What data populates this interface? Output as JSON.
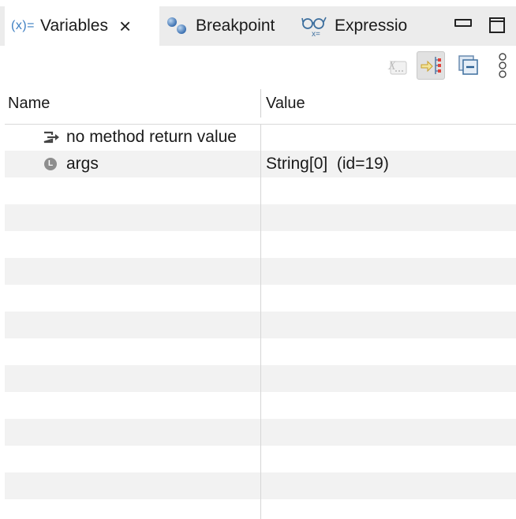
{
  "tabs": [
    {
      "icon_text": "(x)=",
      "icon": "variables-icon",
      "label": "Variables",
      "close": "×",
      "active": true
    },
    {
      "icon": "breakpoint-icon",
      "label": "Breakpoint",
      "active": false
    },
    {
      "icon": "expressions-icon",
      "label": "Expressio",
      "active": false
    }
  ],
  "window_controls": {
    "minimize": "minimize-icon",
    "maximize": "maximize-icon"
  },
  "toolbar": {
    "buttons": [
      {
        "icon": "show-logical-structure-icon",
        "enabled": false
      },
      {
        "icon": "show-type-names-icon",
        "pressed": true
      },
      {
        "icon": "collapse-all-icon",
        "enabled": true
      },
      {
        "icon": "view-menu-icon",
        "enabled": true
      }
    ]
  },
  "columns": {
    "name": "Name",
    "value": "Value"
  },
  "rows": [
    {
      "icon": "return-value-icon",
      "name": "no method return value",
      "value": ""
    },
    {
      "icon": "local-variable-icon",
      "icon_text": "L",
      "name": "args",
      "value": "String[0]  (id=19)"
    }
  ],
  "colors": {
    "accent": "#3d7fc2",
    "tabbar_bg": "#ececec",
    "row_alt": "#f2f2f2"
  }
}
